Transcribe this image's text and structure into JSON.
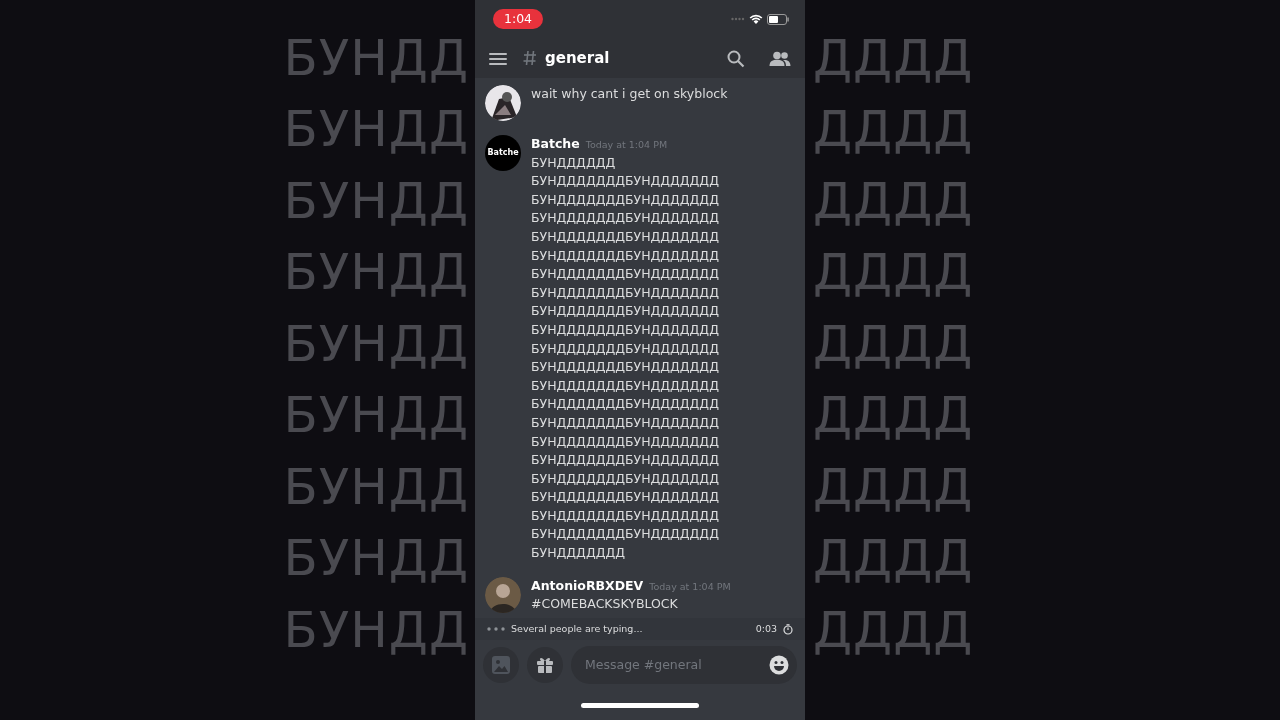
{
  "backdrop": {
    "rows": [
      {
        "left": "БУНДД",
        "right": "ДДДД"
      },
      {
        "left": "БУНДД",
        "right": "ДДДД"
      },
      {
        "left": "БУНДД",
        "right": "ДДДД"
      },
      {
        "left": "БУНДД",
        "right": "ДДДД"
      },
      {
        "left": "БУНДД",
        "right": "ДДДД"
      },
      {
        "left": "БУНДД",
        "right": "ДДДД"
      },
      {
        "left": "БУНДД",
        "right": "ДДДД"
      },
      {
        "left": "БУНДД",
        "right": "ДДДД"
      },
      {
        "left": "БУНДД",
        "right": "ДДДД"
      }
    ]
  },
  "status_bar": {
    "time": "1:04"
  },
  "header": {
    "channel": "general"
  },
  "messages": [
    {
      "lines": [
        "wait why cant i get on skyblock"
      ]
    },
    {
      "author": "Batche",
      "timestamp": "Today at 1:04 PM",
      "avatar": {
        "kind": "text",
        "text": "Batche"
      },
      "lines": [
        "БУНДДДДДД",
        "БУНДДДДДДДБУНДДДДДДД",
        "БУНДДДДДДДБУНДДДДДДД",
        "БУНДДДДДДДБУНДДДДДДД",
        "БУНДДДДДДДБУНДДДДДДД",
        "БУНДДДДДДДБУНДДДДДДД",
        "БУНДДДДДДДБУНДДДДДДД",
        "БУНДДДДДДДБУНДДДДДДД",
        "БУНДДДДДДДБУНДДДДДДД",
        "БУНДДДДДДДБУНДДДДДДД",
        "БУНДДДДДДДБУНДДДДДДД",
        "БУНДДДДДДДБУНДДДДДДД",
        "БУНДДДДДДДБУНДДДДДДД",
        "БУНДДДДДДДБУНДДДДДДД",
        "БУНДДДДДДДБУНДДДДДДД",
        "БУНДДДДДДДБУНДДДДДДД",
        "БУНДДДДДДДБУНДДДДДДД",
        "БУНДДДДДДДБУНДДДДДДД",
        "БУНДДДДДДДБУНДДДДДДД",
        "БУНДДДДДДДБУНДДДДДДД",
        "БУНДДДДДДДБУНДДДДДДД",
        "БУНДДДДДДД"
      ]
    },
    {
      "author": "AntonioRBXDEV",
      "timestamp": "Today at 1:04 PM",
      "avatar": {
        "kind": "person"
      },
      "lines": [
        "#COMEBACKSKYBLOCK"
      ]
    }
  ],
  "typing": {
    "text": "Several people are typing...",
    "timer": "0:03"
  },
  "composer": {
    "placeholder": "Message #general"
  }
}
